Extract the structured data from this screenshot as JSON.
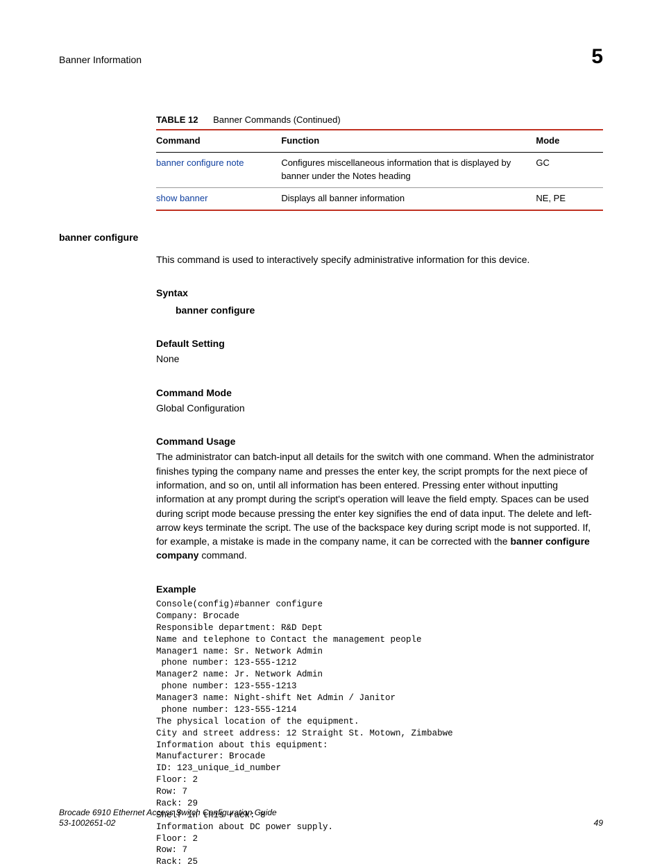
{
  "header": {
    "section_title": "Banner Information",
    "chapter_number": "5"
  },
  "table": {
    "caption_label": "TABLE 12",
    "caption_text": "Banner Commands (Continued)",
    "headers": {
      "command": "Command",
      "function": "Function",
      "mode": "Mode"
    },
    "rows": [
      {
        "command": "banner configure note",
        "function": "Configures miscellaneous information that is displayed by banner under the Notes heading",
        "mode": "GC"
      },
      {
        "command": "show banner",
        "function": "Displays all banner information",
        "mode": "NE, PE"
      }
    ]
  },
  "command_detail": {
    "name": "banner configure",
    "description": "This command is used to interactively specify administrative information for this device.",
    "syntax_label": "Syntax",
    "syntax_value": "banner configure",
    "default_label": "Default Setting",
    "default_value": "None",
    "mode_label": "Command Mode",
    "mode_value": "Global Configuration",
    "usage_label": "Command Usage",
    "usage_text_1": "The administrator can batch-input all details for the switch with one command. When the administrator finishes typing the company name and presses the enter key, the script prompts for the next piece of information, and so on, until all information has been entered. Pressing enter without inputting information at any prompt during the script's operation will leave the field empty. Spaces can be used during script mode because pressing the enter key signifies the end of data input. The delete and left-arrow keys terminate the script. The use of the backspace key during script mode is not supported. If, for example, a mistake is made in the company name, it can be corrected with the ",
    "usage_bold": "banner configure company",
    "usage_text_2": " command.",
    "example_label": "Example",
    "example_code": "Console(config)#banner configure\nCompany: Brocade\nResponsible department: R&D Dept\nName and telephone to Contact the management people\nManager1 name: Sr. Network Admin\n phone number: 123-555-1212\nManager2 name: Jr. Network Admin\n phone number: 123-555-1213\nManager3 name: Night-shift Net Admin / Janitor\n phone number: 123-555-1214\nThe physical location of the equipment.\nCity and street address: 12 Straight St. Motown, Zimbabwe\nInformation about this equipment:\nManufacturer: Brocade\nID: 123_unique_id_number\nFloor: 2\nRow: 7\nRack: 29\nShelf in this rack: 8\nInformation about DC power supply.\nFloor: 2\nRow: 7\nRack: 25"
  },
  "footer": {
    "doc_title": "Brocade 6910 Ethernet Access Switch Configuration Guide",
    "doc_number": "53-1002651-02",
    "page_number": "49"
  }
}
